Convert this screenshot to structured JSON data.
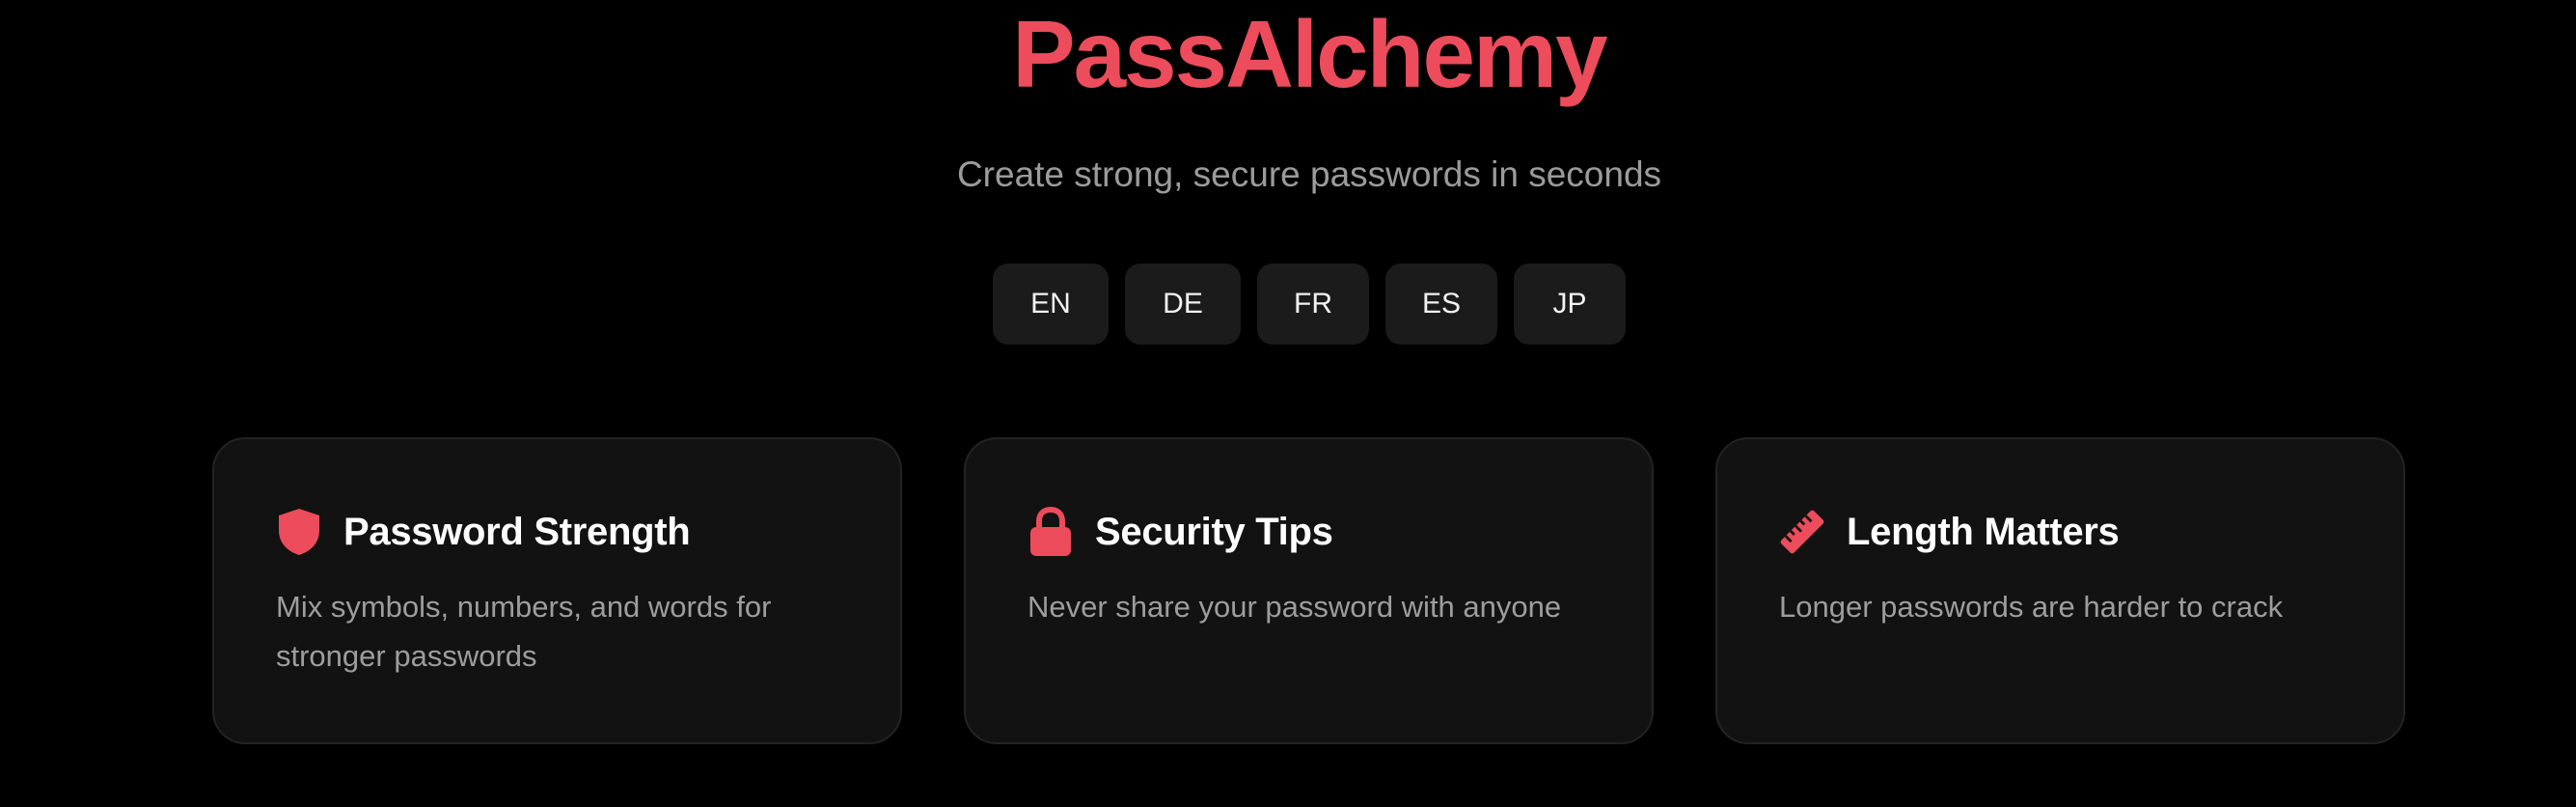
{
  "app": {
    "title": "PassAlchemy",
    "subtitle": "Create strong, secure passwords in seconds",
    "accent_color": "#ec4c5b"
  },
  "languages": [
    {
      "code": "EN"
    },
    {
      "code": "DE"
    },
    {
      "code": "FR"
    },
    {
      "code": "ES"
    },
    {
      "code": "JP"
    }
  ],
  "cards": [
    {
      "icon": "shield-icon",
      "title": "Password Strength",
      "text": "Mix symbols, numbers, and words for stronger passwords"
    },
    {
      "icon": "lock-icon",
      "title": "Security Tips",
      "text": "Never share your password with anyone"
    },
    {
      "icon": "ruler-icon",
      "title": "Length Matters",
      "text": "Longer passwords are harder to crack"
    }
  ]
}
